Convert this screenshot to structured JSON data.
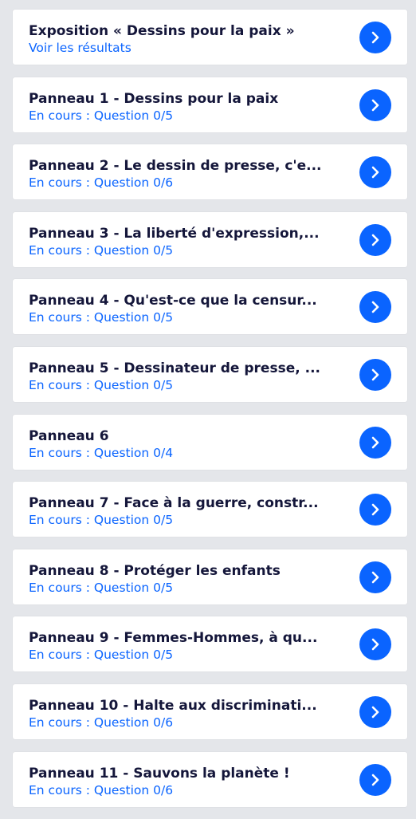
{
  "colors": {
    "background": "#e4e6ea",
    "card": "#ffffff",
    "title": "#14163a",
    "accent": "#0a64ff"
  },
  "items": [
    {
      "title": "Exposition « Dessins pour la paix »",
      "subtitle": "Voir les résultats",
      "icon": "chevron-right-icon"
    },
    {
      "title": "Panneau 1 - Dessins pour la paix",
      "subtitle": "En cours : Question 0/5",
      "icon": "chevron-right-icon"
    },
    {
      "title": "Panneau 2 - Le dessin de presse, c'e...",
      "subtitle": "En cours : Question 0/6",
      "icon": "chevron-right-icon"
    },
    {
      "title": "Panneau 3 - La liberté d'expression,...",
      "subtitle": "En cours : Question 0/5",
      "icon": "chevron-right-icon"
    },
    {
      "title": "Panneau 4 - Qu'est-ce que la censur...",
      "subtitle": "En cours : Question 0/5",
      "icon": "chevron-right-icon"
    },
    {
      "title": "Panneau 5 - Dessinateur de presse, ...",
      "subtitle": "En cours : Question 0/5",
      "icon": "chevron-right-icon"
    },
    {
      "title": "Panneau 6",
      "subtitle": "En cours : Question 0/4",
      "icon": "chevron-right-icon"
    },
    {
      "title": "Panneau 7 - Face à la guerre, constr...",
      "subtitle": "En cours : Question 0/5",
      "icon": "chevron-right-icon"
    },
    {
      "title": "Panneau 8 - Protéger les enfants",
      "subtitle": "En cours : Question 0/5",
      "icon": "chevron-right-icon"
    },
    {
      "title": "Panneau 9 - Femmes-Hommes, à qu...",
      "subtitle": "En cours : Question 0/5",
      "icon": "chevron-right-icon"
    },
    {
      "title": "Panneau 10 - Halte aux discriminati...",
      "subtitle": "En cours : Question 0/6",
      "icon": "chevron-right-icon"
    },
    {
      "title": "Panneau 11 - Sauvons la planète !",
      "subtitle": "En cours : Question 0/6",
      "icon": "chevron-right-icon"
    }
  ]
}
